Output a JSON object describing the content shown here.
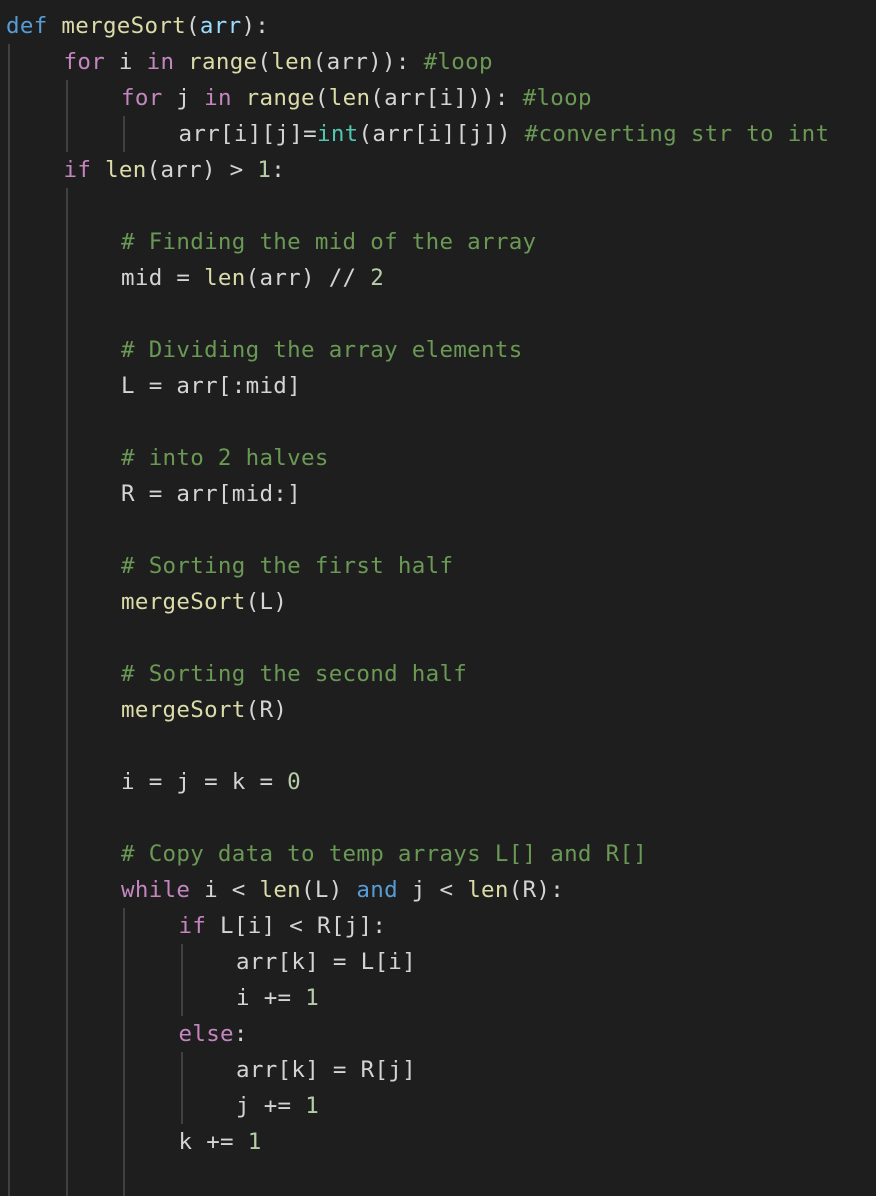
{
  "editor": {
    "language": "python",
    "lines": [
      {
        "indent": 0,
        "tokens": [
          [
            "kw-def",
            "def"
          ],
          [
            "txt",
            " "
          ],
          [
            "fn",
            "mergeSort"
          ],
          [
            "txt",
            "("
          ],
          [
            "param",
            "arr"
          ],
          [
            "txt",
            "):"
          ]
        ]
      },
      {
        "indent": 1,
        "tokens": [
          [
            "ctrl",
            "for"
          ],
          [
            "txt",
            " i "
          ],
          [
            "ctrl",
            "in"
          ],
          [
            "txt",
            " "
          ],
          [
            "fn",
            "range"
          ],
          [
            "txt",
            "("
          ],
          [
            "fn",
            "len"
          ],
          [
            "txt",
            "(arr)): "
          ],
          [
            "cmt",
            "#loop"
          ]
        ]
      },
      {
        "indent": 2,
        "tokens": [
          [
            "ctrl",
            "for"
          ],
          [
            "txt",
            " j "
          ],
          [
            "ctrl",
            "in"
          ],
          [
            "txt",
            " "
          ],
          [
            "fn",
            "range"
          ],
          [
            "txt",
            "("
          ],
          [
            "fn",
            "len"
          ],
          [
            "txt",
            "(arr[i])): "
          ],
          [
            "cmt",
            "#loop"
          ]
        ]
      },
      {
        "indent": 3,
        "tokens": [
          [
            "txt",
            "arr[i][j]="
          ],
          [
            "builtin-cls",
            "int"
          ],
          [
            "txt",
            "(arr[i][j]) "
          ],
          [
            "cmt",
            "#converting str to int"
          ]
        ]
      },
      {
        "indent": 1,
        "tokens": [
          [
            "ctrl",
            "if"
          ],
          [
            "txt",
            " "
          ],
          [
            "fn",
            "len"
          ],
          [
            "txt",
            "(arr) > "
          ],
          [
            "num",
            "1"
          ],
          [
            "txt",
            ":"
          ]
        ]
      },
      {
        "indent": 0,
        "tokens": []
      },
      {
        "indent": 2,
        "tokens": [
          [
            "cmt",
            "# Finding the mid of the array"
          ]
        ]
      },
      {
        "indent": 2,
        "tokens": [
          [
            "txt",
            "mid = "
          ],
          [
            "fn",
            "len"
          ],
          [
            "txt",
            "(arr) // "
          ],
          [
            "num",
            "2"
          ]
        ]
      },
      {
        "indent": 0,
        "tokens": []
      },
      {
        "indent": 2,
        "tokens": [
          [
            "cmt",
            "# Dividing the array elements"
          ]
        ]
      },
      {
        "indent": 2,
        "tokens": [
          [
            "txt",
            "L = arr[:mid]"
          ]
        ]
      },
      {
        "indent": 0,
        "tokens": []
      },
      {
        "indent": 2,
        "tokens": [
          [
            "cmt",
            "# into 2 halves"
          ]
        ]
      },
      {
        "indent": 2,
        "tokens": [
          [
            "txt",
            "R = arr[mid:]"
          ]
        ]
      },
      {
        "indent": 0,
        "tokens": []
      },
      {
        "indent": 2,
        "tokens": [
          [
            "cmt",
            "# Sorting the first half"
          ]
        ]
      },
      {
        "indent": 2,
        "tokens": [
          [
            "fn",
            "mergeSort"
          ],
          [
            "txt",
            "(L)"
          ]
        ]
      },
      {
        "indent": 0,
        "tokens": []
      },
      {
        "indent": 2,
        "tokens": [
          [
            "cmt",
            "# Sorting the second half"
          ]
        ]
      },
      {
        "indent": 2,
        "tokens": [
          [
            "fn",
            "mergeSort"
          ],
          [
            "txt",
            "(R)"
          ]
        ]
      },
      {
        "indent": 0,
        "tokens": []
      },
      {
        "indent": 2,
        "tokens": [
          [
            "txt",
            "i = j = k = "
          ],
          [
            "num",
            "0"
          ]
        ]
      },
      {
        "indent": 0,
        "tokens": []
      },
      {
        "indent": 2,
        "tokens": [
          [
            "cmt",
            "# Copy data to temp arrays L[] and R[]"
          ]
        ]
      },
      {
        "indent": 2,
        "tokens": [
          [
            "ctrl",
            "while"
          ],
          [
            "txt",
            " i < "
          ],
          [
            "fn",
            "len"
          ],
          [
            "txt",
            "(L) "
          ],
          [
            "op-and",
            "and"
          ],
          [
            "txt",
            " j < "
          ],
          [
            "fn",
            "len"
          ],
          [
            "txt",
            "(R):"
          ]
        ]
      },
      {
        "indent": 3,
        "tokens": [
          [
            "ctrl",
            "if"
          ],
          [
            "txt",
            " L[i] < R[j]:"
          ]
        ]
      },
      {
        "indent": 4,
        "tokens": [
          [
            "txt",
            "arr[k] = L[i]"
          ]
        ]
      },
      {
        "indent": 4,
        "tokens": [
          [
            "txt",
            "i += "
          ],
          [
            "num",
            "1"
          ]
        ]
      },
      {
        "indent": 3,
        "tokens": [
          [
            "ctrl",
            "else"
          ],
          [
            "txt",
            ":"
          ]
        ]
      },
      {
        "indent": 4,
        "tokens": [
          [
            "txt",
            "arr[k] = R[j]"
          ]
        ]
      },
      {
        "indent": 4,
        "tokens": [
          [
            "txt",
            "j += "
          ],
          [
            "num",
            "1"
          ]
        ]
      },
      {
        "indent": 3,
        "tokens": [
          [
            "txt",
            "k += "
          ],
          [
            "num",
            "1"
          ]
        ]
      },
      {
        "indent": 0,
        "tokens": []
      }
    ]
  }
}
